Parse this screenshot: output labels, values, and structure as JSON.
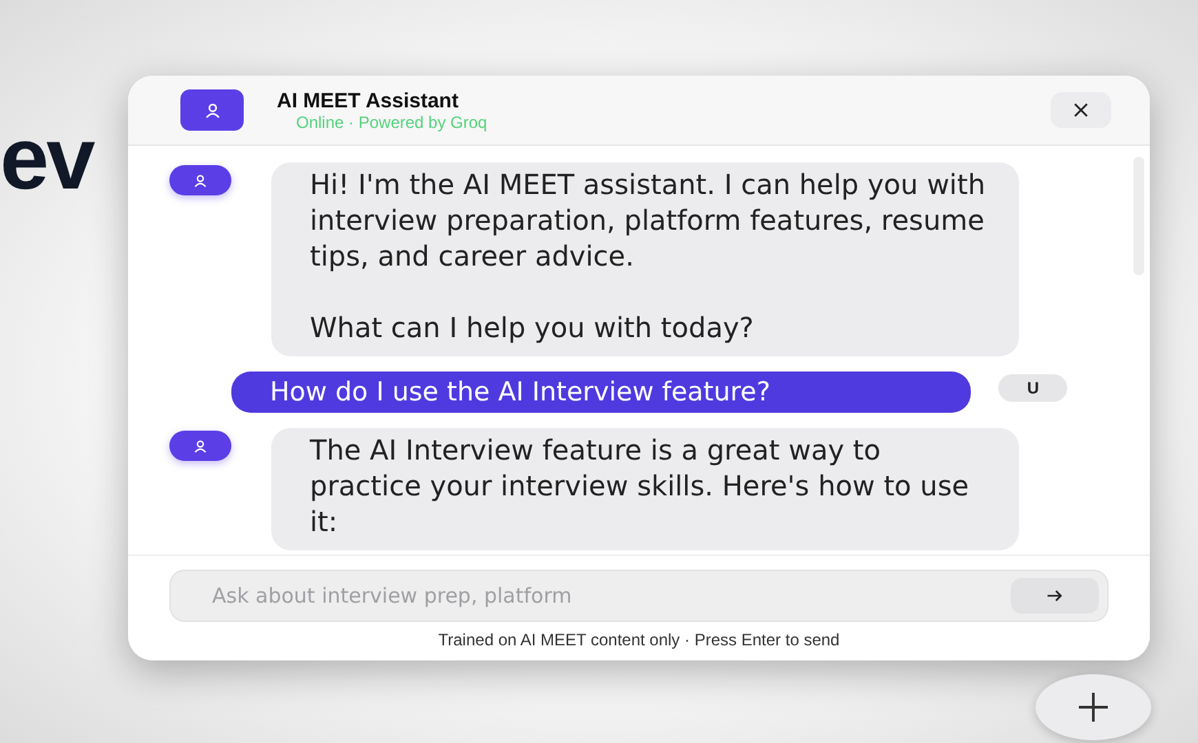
{
  "page": {
    "heading": "ev"
  },
  "chat": {
    "title": "AI MEET Assistant",
    "subtitle": "Online · Powered by Groq",
    "messages": [
      {
        "kind": "bot",
        "text": "Hi! I'm the AI MEET assistant. I can help you with interview preparation, platform features, resume tips, and career advice.\n\nWhat can I help you with today?"
      },
      {
        "kind": "user",
        "avatar": "U",
        "text": "How do I use the AI Interview feature?"
      },
      {
        "kind": "bot",
        "text": "The AI Interview feature is a great way to practice your interview skills. Here's how to use it:"
      }
    ],
    "input": {
      "placeholder": "Ask about interview prep, platform"
    },
    "footnote": "Trained on AI MEET content only · Press Enter to send"
  }
}
